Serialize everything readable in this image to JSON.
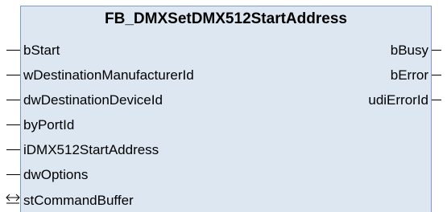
{
  "block": {
    "title": "FB_DMXSetDMX512StartAddress",
    "inputs": [
      "bStart",
      "wDestinationManufacturerId",
      "dwDestinationDeviceId",
      "byPortId",
      "iDMX512StartAddress",
      "dwOptions"
    ],
    "outputs": [
      "bBusy",
      "bError",
      "udiErrorId"
    ],
    "inouts": [
      "stCommandBuffer"
    ]
  },
  "colors": {
    "block_fill": "#dde7f2",
    "block_border": "#7d9bc4",
    "pin_line": "#000000"
  },
  "icons": {
    "inout": "double-arrow-icon"
  }
}
